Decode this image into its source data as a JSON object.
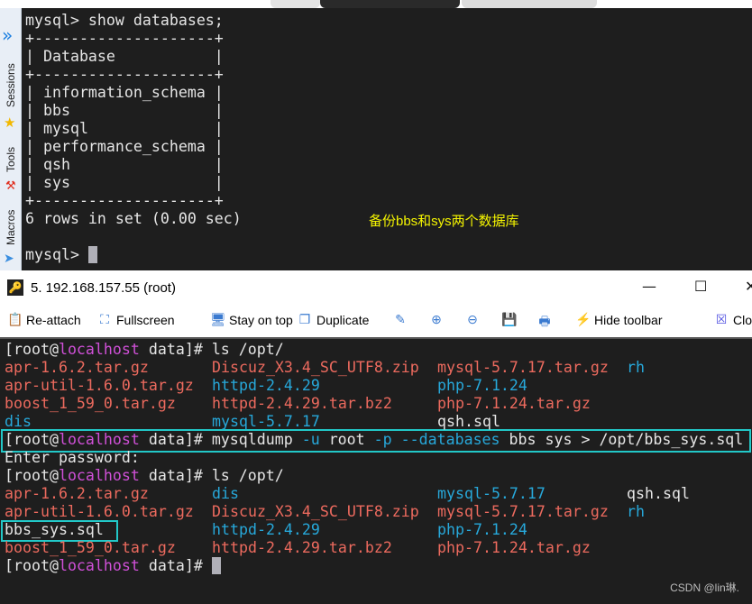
{
  "colors": {
    "archive": "#ec6a5e",
    "dir": "#27a8da",
    "host": "#d050d8",
    "text": "#e6e6e6",
    "note": "#f5f500",
    "highlight": "#22c8c8"
  },
  "sidebar": {
    "items": [
      "Sessions",
      "Tools",
      "Macros"
    ]
  },
  "mysql": {
    "lines": [
      "mysql> show databases;",
      "+--------------------+",
      "| Database           |",
      "+--------------------+",
      "| information_schema |",
      "| bbs                |",
      "| mysql              |",
      "| performance_schema |",
      "| qsh                |",
      "| sys                |",
      "+--------------------+",
      "6 rows in set (0.00 sec)",
      "",
      "mysql> "
    ]
  },
  "annotation": "备份bbs和sys两个数据库",
  "window": {
    "title": "5. 192.168.157.55 (root)",
    "minimize": "—",
    "maximize": "☐",
    "close": "✕"
  },
  "toolbar": [
    {
      "label": "Re-attach",
      "icon": "clipboard-icon",
      "glyph": "📋"
    },
    {
      "label": "Fullscreen",
      "icon": "fullscreen-icon",
      "glyph": "⛶"
    },
    {
      "label": "Stay on top",
      "icon": "monitor-lock-icon",
      "glyph": "🖥"
    },
    {
      "label": "Duplicate",
      "icon": "duplicate-icon",
      "glyph": "❐"
    },
    {
      "label": "",
      "icon": "edit-icon",
      "glyph": "✎"
    },
    {
      "label": "",
      "icon": "zoom-in-icon",
      "glyph": "⊕"
    },
    {
      "label": "",
      "icon": "zoom-out-icon",
      "glyph": "⊖"
    },
    {
      "label": "",
      "icon": "save-icon",
      "glyph": "💾"
    },
    {
      "label": "",
      "icon": "print-icon",
      "glyph": "🖶"
    },
    {
      "label": "Hide toolbar",
      "icon": "lightning-icon",
      "glyph": "⚡"
    },
    {
      "label": "Clo",
      "icon": "close-x-icon",
      "glyph": "☒"
    }
  ],
  "shell": {
    "prompt": {
      "open": "[root@",
      "host": "localhost",
      "close": " data]# "
    },
    "lines": [
      {
        "type": "cmd",
        "cmd": "ls /opt/"
      },
      {
        "type": "ls",
        "cols": [
          [
            "apr-1.6.2.tar.gz",
            "archive"
          ],
          [
            "Discuz_X3.4_SC_UTF8.zip",
            "archive"
          ],
          [
            "mysql-5.7.17.tar.gz",
            "archive"
          ],
          [
            "rh",
            "dir"
          ]
        ]
      },
      {
        "type": "ls",
        "cols": [
          [
            "apr-util-1.6.0.tar.gz",
            "archive"
          ],
          [
            "httpd-2.4.29",
            "dir"
          ],
          [
            "php-7.1.24",
            "dir"
          ],
          [
            "",
            ""
          ]
        ]
      },
      {
        "type": "ls",
        "cols": [
          [
            "boost_1_59_0.tar.gz",
            "archive"
          ],
          [
            "httpd-2.4.29.tar.bz2",
            "archive"
          ],
          [
            "php-7.1.24.tar.gz",
            "archive"
          ],
          [
            "",
            ""
          ]
        ]
      },
      {
        "type": "ls",
        "cols": [
          [
            "dis",
            "dir"
          ],
          [
            "mysql-5.7.17",
            "dir"
          ],
          [
            "qsh.sql",
            "text"
          ],
          [
            "",
            ""
          ]
        ]
      },
      {
        "type": "dump",
        "segs": [
          [
            "mysqldump ",
            "text"
          ],
          [
            "-u",
            "dir"
          ],
          [
            " root ",
            "text"
          ],
          [
            "-p",
            "dir"
          ],
          [
            " ",
            "text"
          ],
          [
            "--databases",
            "dir"
          ],
          [
            " bbs sys > /opt/bbs_sys.sql",
            "text"
          ]
        ]
      },
      {
        "type": "text",
        "text": "Enter password:"
      },
      {
        "type": "cmd",
        "cmd": "ls /opt/"
      },
      {
        "type": "ls",
        "cols": [
          [
            "apr-1.6.2.tar.gz",
            "archive"
          ],
          [
            "dis",
            "dir"
          ],
          [
            "mysql-5.7.17",
            "dir"
          ],
          [
            "qsh.sql",
            "text"
          ]
        ]
      },
      {
        "type": "ls",
        "cols": [
          [
            "apr-util-1.6.0.tar.gz",
            "archive"
          ],
          [
            "Discuz_X3.4_SC_UTF8.zip",
            "archive"
          ],
          [
            "mysql-5.7.17.tar.gz",
            "archive"
          ],
          [
            "rh",
            "dir"
          ]
        ]
      },
      {
        "type": "ls",
        "cols": [
          [
            "bbs_sys.sql",
            "text"
          ],
          [
            "httpd-2.4.29",
            "dir"
          ],
          [
            "php-7.1.24",
            "dir"
          ],
          [
            "",
            ""
          ]
        ]
      },
      {
        "type": "ls",
        "cols": [
          [
            "boost_1_59_0.tar.gz",
            "archive"
          ],
          [
            "httpd-2.4.29.tar.bz2",
            "archive"
          ],
          [
            "php-7.1.24.tar.gz",
            "archive"
          ],
          [
            "",
            ""
          ]
        ]
      },
      {
        "type": "cmd",
        "cmd": "",
        "cursor": true
      }
    ]
  },
  "watermark": "CSDN @lin琳."
}
